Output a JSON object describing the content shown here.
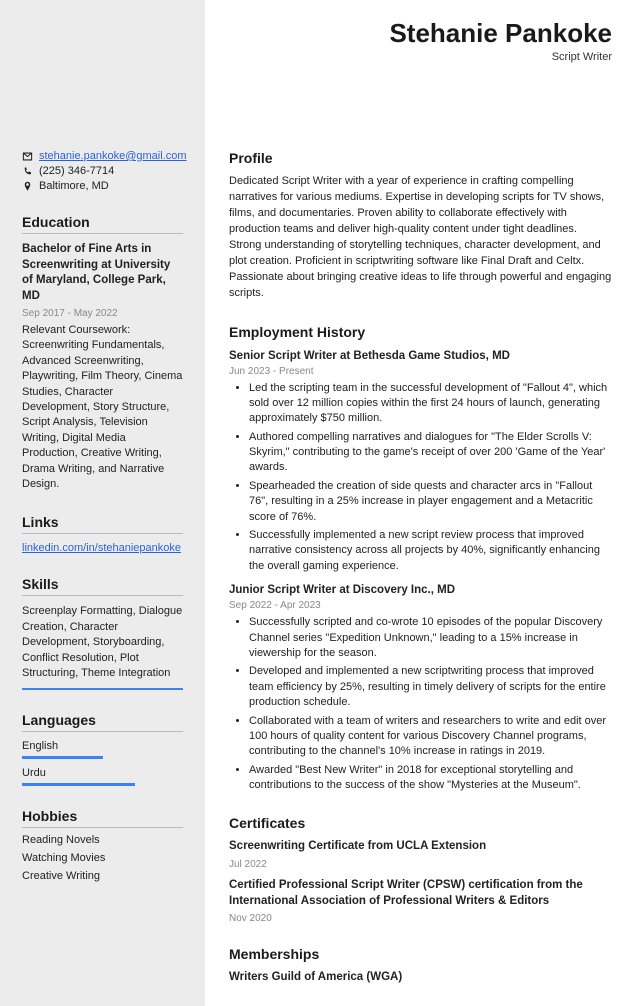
{
  "header": {
    "name": "Stehanie Pankoke",
    "role": "Script Writer"
  },
  "contact": {
    "email": "stehanie.pankoke@gmail.com",
    "phone": "(225) 346-7714",
    "location": "Baltimore, MD"
  },
  "education": {
    "heading": "Education",
    "degree": "Bachelor of Fine Arts in Screenwriting at University of Maryland, College Park, MD",
    "dates": "Sep 2017 - May 2022",
    "coursework": "Relevant Coursework: Screenwriting Fundamentals, Advanced Screenwriting, Playwriting, Film Theory, Cinema Studies, Character Development, Story Structure, Script Analysis, Television Writing, Digital Media Production, Creative Writing, Drama Writing, and Narrative Design."
  },
  "links": {
    "heading": "Links",
    "url": "linkedin.com/in/stehaniepankoke"
  },
  "skills": {
    "heading": "Skills",
    "text": "Screenplay Formatting, Dialogue Creation, Character Development, Storyboarding, Conflict Resolution, Plot Structuring, Theme Integration"
  },
  "languages": {
    "heading": "Languages",
    "items": [
      "English",
      "Urdu"
    ]
  },
  "hobbies": {
    "heading": "Hobbies",
    "items": [
      "Reading Novels",
      "Watching Movies",
      "Creative Writing"
    ]
  },
  "profile": {
    "heading": "Profile",
    "text": "Dedicated Script Writer with a year of experience in crafting compelling narratives for various mediums. Expertise in developing scripts for TV shows, films, and documentaries. Proven ability to collaborate effectively with production teams and deliver high-quality content under tight deadlines. Strong understanding of storytelling techniques, character development, and plot creation. Proficient in scriptwriting software like Final Draft and Celtx. Passionate about bringing creative ideas to life through powerful and engaging scripts."
  },
  "employment": {
    "heading": "Employment History",
    "jobs": [
      {
        "title": "Senior Script Writer at Bethesda Game Studios, MD",
        "dates": "Jun 2023 - Present",
        "bullets": [
          "Led the scripting team in the successful development of \"Fallout 4\", which sold over 12 million copies within the first 24 hours of launch, generating approximately $750 million.",
          "Authored compelling narratives and dialogues for \"The Elder Scrolls V: Skyrim,\" contributing to the game's receipt of over 200 'Game of the Year' awards.",
          "Spearheaded the creation of side quests and character arcs in \"Fallout 76\", resulting in a 25% increase in player engagement and a Metacritic score of 76%.",
          "Successfully implemented a new script review process that improved narrative consistency across all projects by 40%, significantly enhancing the overall gaming experience."
        ]
      },
      {
        "title": "Junior Script Writer at Discovery Inc., MD",
        "dates": "Sep 2022 - Apr 2023",
        "bullets": [
          "Successfully scripted and co-wrote 10 episodes of the popular Discovery Channel series \"Expedition Unknown,\" leading to a 15% increase in viewership for the season.",
          "Developed and implemented a new scriptwriting process that improved team efficiency by 25%, resulting in timely delivery of scripts for the entire production schedule.",
          "Collaborated with a team of writers and researchers to write and edit over 100 hours of quality content for various Discovery Channel programs, contributing to the channel's 10% increase in ratings in 2019.",
          "Awarded \"Best New Writer\" in 2018 for exceptional storytelling and contributions to the success of the show \"Mysteries at the Museum\"."
        ]
      }
    ]
  },
  "certificates": {
    "heading": "Certificates",
    "items": [
      {
        "title": "Screenwriting Certificate from UCLA Extension",
        "date": "Jul 2022"
      },
      {
        "title": "Certified Professional Script Writer (CPSW) certification from the International Association of Professional Writers & Editors",
        "date": "Nov 2020"
      }
    ]
  },
  "memberships": {
    "heading": "Memberships",
    "items": [
      "Writers Guild of America (WGA)"
    ]
  }
}
